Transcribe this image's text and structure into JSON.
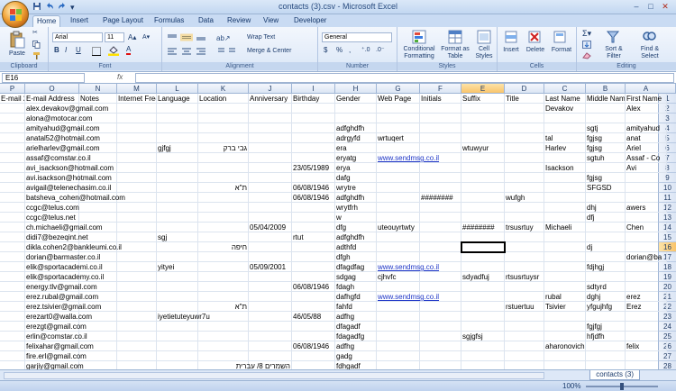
{
  "window": {
    "title": "contacts (3).csv - Microsoft Excel",
    "qat": [
      "save-icon",
      "undo-icon",
      "redo-icon"
    ],
    "controls": [
      "–",
      "□",
      "✕"
    ]
  },
  "tabs": [
    "Home",
    "Insert",
    "Page Layout",
    "Formulas",
    "Data",
    "Review",
    "View",
    "Developer"
  ],
  "active_tab": "Home",
  "ribbon": {
    "clipboard": {
      "label": "Clipboard",
      "paste": "Paste"
    },
    "font": {
      "label": "Font",
      "name": "Arial",
      "size": "11",
      "bold": "B",
      "italic": "I",
      "underline": "U"
    },
    "alignment": {
      "label": "Alignment",
      "wrap": "Wrap Text",
      "merge": "Merge & Center"
    },
    "number": {
      "label": "Number",
      "format": "General",
      "currency": "$",
      "percent": "%",
      "comma": ","
    },
    "styles": {
      "label": "Styles",
      "conditional": "Conditional Formatting",
      "table": "Format as Table",
      "cell": "Cell Styles"
    },
    "cells": {
      "label": "Cells",
      "insert": "Insert",
      "delete": "Delete",
      "format": "Format"
    },
    "editing": {
      "label": "Editing",
      "sort": "Sort & Filter",
      "find": "Find & Select"
    }
  },
  "formula_bar": {
    "name_box": "E16",
    "fx": "fx",
    "value": ""
  },
  "columns": [
    {
      "letter": "P",
      "header": "E-mail 2 Address"
    },
    {
      "letter": "O",
      "header": "E-mail Address"
    },
    {
      "letter": "N",
      "header": "Notes"
    },
    {
      "letter": "M",
      "header": "Internet Free Busy"
    },
    {
      "letter": "L",
      "header": "Language"
    },
    {
      "letter": "K",
      "header": "Location"
    },
    {
      "letter": "J",
      "header": "Anniversary"
    },
    {
      "letter": "I",
      "header": "Birthday"
    },
    {
      "letter": "H",
      "header": "Gender"
    },
    {
      "letter": "G",
      "header": "Web Page"
    },
    {
      "letter": "F",
      "header": "Initials"
    },
    {
      "letter": "E",
      "header": "Suffix"
    },
    {
      "letter": "D",
      "header": "Title"
    },
    {
      "letter": "C",
      "header": "Last Name"
    },
    {
      "letter": "B",
      "header": "Middle Name"
    },
    {
      "letter": "A",
      "header": "First Name"
    }
  ],
  "selected_cell": {
    "col": "E",
    "row": 16
  },
  "rows": [
    {
      "n": 2,
      "O": "alex.devakov@gmail.com",
      "C": "Devakov",
      "A": "Alex"
    },
    {
      "n": 3,
      "O": "alona@motocar.com"
    },
    {
      "n": 4,
      "O": "amityahud@gmail.com",
      "H": "adfghdfh",
      "B": "sgtj",
      "A": "amityahud"
    },
    {
      "n": 5,
      "O": "anatal52@hotmail.com",
      "H": "adrgyfd",
      "G": "wrtuqert",
      "C": "tal",
      "B": "fgjsg",
      "A": "anat"
    },
    {
      "n": 6,
      "O": "arielharlev@gmail.com",
      "L": "gjfgj",
      "K": "גבי ברק",
      "H": "era",
      "E": "wtuwyur",
      "C": "Harlev",
      "B": "fgjsg",
      "A": "Ariel"
    },
    {
      "n": 7,
      "O": "assaf@comstar.co.il",
      "H": "eryatg",
      "G": "www.sendmsg.co.il",
      "B": "sgtuh",
      "A": "Assaf - Co"
    },
    {
      "n": 8,
      "O": "avi_isackson@hotmail.com",
      "I": "23/05/1989",
      "H": "erya",
      "C": "Isackson",
      "A": "Avi"
    },
    {
      "n": 9,
      "O": "avi.isackson@hotmail.com",
      "H": "dafg",
      "B": "fgjsg"
    },
    {
      "n": 10,
      "O": "avigail@telenechasim.co.il",
      "K": "ת\"א",
      "I": "06/08/1946",
      "H": "wrytre",
      "B": "SFGSD"
    },
    {
      "n": 11,
      "O": "batsheva_cohen@hotmail.com",
      "I": "06/08/1946",
      "H": "adfghdfh",
      "F": "########",
      "D": "wufgh"
    },
    {
      "n": 12,
      "O": "ccgc@telus.com",
      "H": "wrytfrh",
      "B": "dhj",
      "A": "awers"
    },
    {
      "n": 13,
      "O": "ccgc@telus.net",
      "H": "w",
      "B": "dfj"
    },
    {
      "n": 14,
      "O": "ch.michaeli@gmail.com",
      "J": "05/04/2009",
      "H": "dfg",
      "G": "uteouyrtwty",
      "E": "########",
      "D": "trsusrtuy",
      "C": "Michaeli",
      "A": "Chen"
    },
    {
      "n": 15,
      "O": "didi7@bezeqint.net",
      "L": "sgj",
      "I": "rtut",
      "H": "adfghdfh"
    },
    {
      "n": 16,
      "O": "dikla.cohen2@bankleumi.co.il",
      "K": "חיפה",
      "H": "adthfd",
      "B": "dj"
    },
    {
      "n": 17,
      "O": "dorian@barmaster.co.il",
      "H": "dfgh",
      "A": "dorian@ba"
    },
    {
      "n": 18,
      "O": "elik@sportacademi.co.il",
      "L": "yityei",
      "J": "05/09/2001",
      "H": "dfagdfag",
      "G": "www.sendmsg.co.il",
      "B": "fdjhgj"
    },
    {
      "n": 19,
      "O": "elik@sportacademy.co.il",
      "H": "sdgag",
      "G": "cjhvfc",
      "E": "sdyadfuj",
      "D": "rtsusrtuysr"
    },
    {
      "n": 20,
      "O": "energy.tlv@gmail.com",
      "I": "06/08/1946",
      "H": "fdagh",
      "B": "sdtyrd"
    },
    {
      "n": 21,
      "O": "erez.rubal@gmail.com",
      "H": "dafhgfd",
      "G": "www.sendmsg.co.il",
      "C": "rubal",
      "B": "dghj",
      "A": "erez"
    },
    {
      "n": 22,
      "O": "erez.tsivier@gmail.com",
      "K": "ת\"א",
      "H": "fahfd",
      "D": "rstuertuu",
      "C": "Tsivier",
      "B": "yfgujhfg",
      "A": "Erez"
    },
    {
      "n": 23,
      "O": "erezart0@walla.com",
      "L": "iyetietuteyuwr7u",
      "I": "46/05/88",
      "H": "adfhg"
    },
    {
      "n": 24,
      "O": "erezgt@gmail.com",
      "H": "dfagadf",
      "B": "fgjfgj"
    },
    {
      "n": 25,
      "O": "erlin@comstar.co.il",
      "H": "fdagadfg",
      "E": "sgjgfsj",
      "B": "hfjdfh"
    },
    {
      "n": 26,
      "O": "felixahar@gmail.com",
      "I": "06/08/1946",
      "H": "adfhg",
      "C": "aharonovich",
      "A": "felix"
    },
    {
      "n": 27,
      "O": "fire.erl@gmail.com",
      "H": "gadg"
    },
    {
      "n": 28,
      "O": "garjiy@gmail.com",
      "K": "השמרים 8/ עברית",
      "H": "fdhgadf"
    },
    {
      "n": 29,
      "O": "gavrielpaz@gmail.com",
      "H": "adfhg"
    },
    {
      "n": 30,
      "O": "gofer5@zahav.net.il",
      "G": "www.sendmsg.co.il",
      "A": "gofer5@za"
    }
  ],
  "sheet": {
    "tab": "contacts (3)",
    "zoom": "100%"
  }
}
